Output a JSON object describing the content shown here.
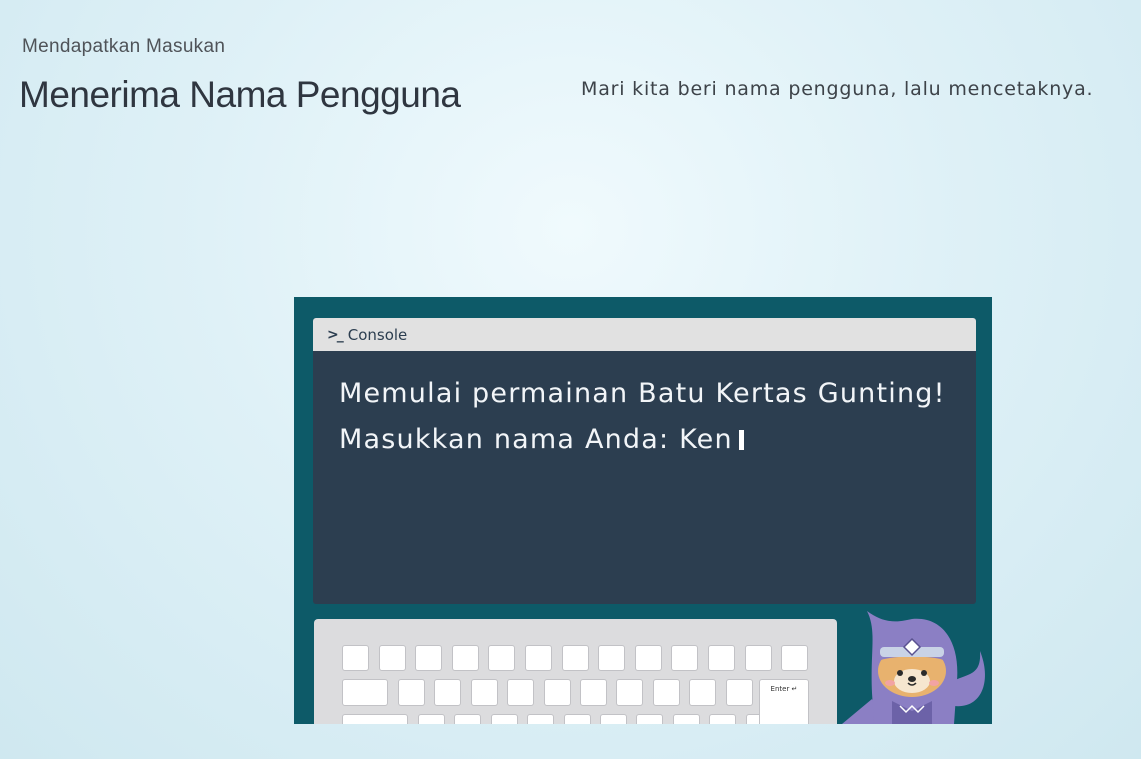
{
  "header": {
    "subtitle": "Mendapatkan Masukan",
    "title": "Menerima Nama Pengguna",
    "description": "Mari kita beri nama pengguna, lalu mencetaknya."
  },
  "console": {
    "tab_label": "Console",
    "lines": [
      "Memulai permainan Batu Kertas Gunting!",
      "Masukkan nama Anda: Ken"
    ]
  },
  "keyboard": {
    "enter_label": "Enter ↵"
  },
  "colors": {
    "stage": "#0d5a68",
    "console_bg": "#2c3e50",
    "console_bar": "#e1e1e1",
    "keyboard_bg": "#dcdcde",
    "mascot": "#8b7fc4"
  },
  "icons": [
    "terminal-prompt-icon",
    "ninja-mascot"
  ]
}
